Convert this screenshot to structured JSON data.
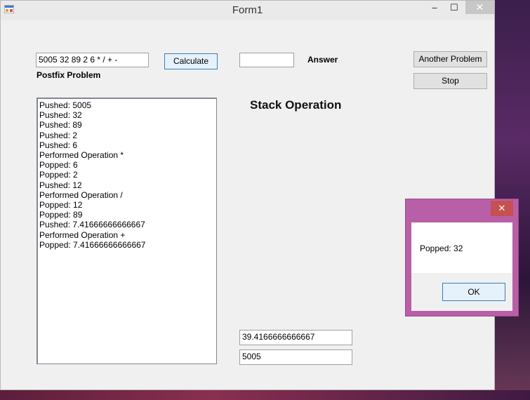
{
  "window": {
    "title": "Form1",
    "controls": {
      "minimize": "‒",
      "maximize": "☐",
      "close": "✕"
    }
  },
  "form": {
    "postfix_input": "5005 32 89 2 6 * / + -",
    "postfix_label": "Postfix Problem",
    "calculate_label": "Calculate",
    "answer_value": "",
    "answer_label": "Answer",
    "another_label": "Another Problem",
    "stop_label": "Stop",
    "stack_title": "Stack Operation",
    "result_1": "39.4166666666667",
    "result_2": "5005"
  },
  "log": [
    "Pushed: 5005",
    "Pushed: 32",
    "Pushed: 89",
    "Pushed: 2",
    "Pushed: 6",
    "Performed Operation *",
    "Popped: 6",
    "Popped: 2",
    "Pushed: 12",
    "Performed Operation /",
    "Popped: 12",
    "Popped: 89",
    "Pushed: 7.41666666666667",
    "Performed Operation +",
    "Popped: 7.41666666666667"
  ],
  "dialog": {
    "message": "Popped: 32",
    "ok_label": "OK",
    "close": "✕"
  },
  "colors": {
    "dialog_frame": "#b95fa8",
    "close_red": "#c75050",
    "focus_blue": "#3c7fb1"
  }
}
